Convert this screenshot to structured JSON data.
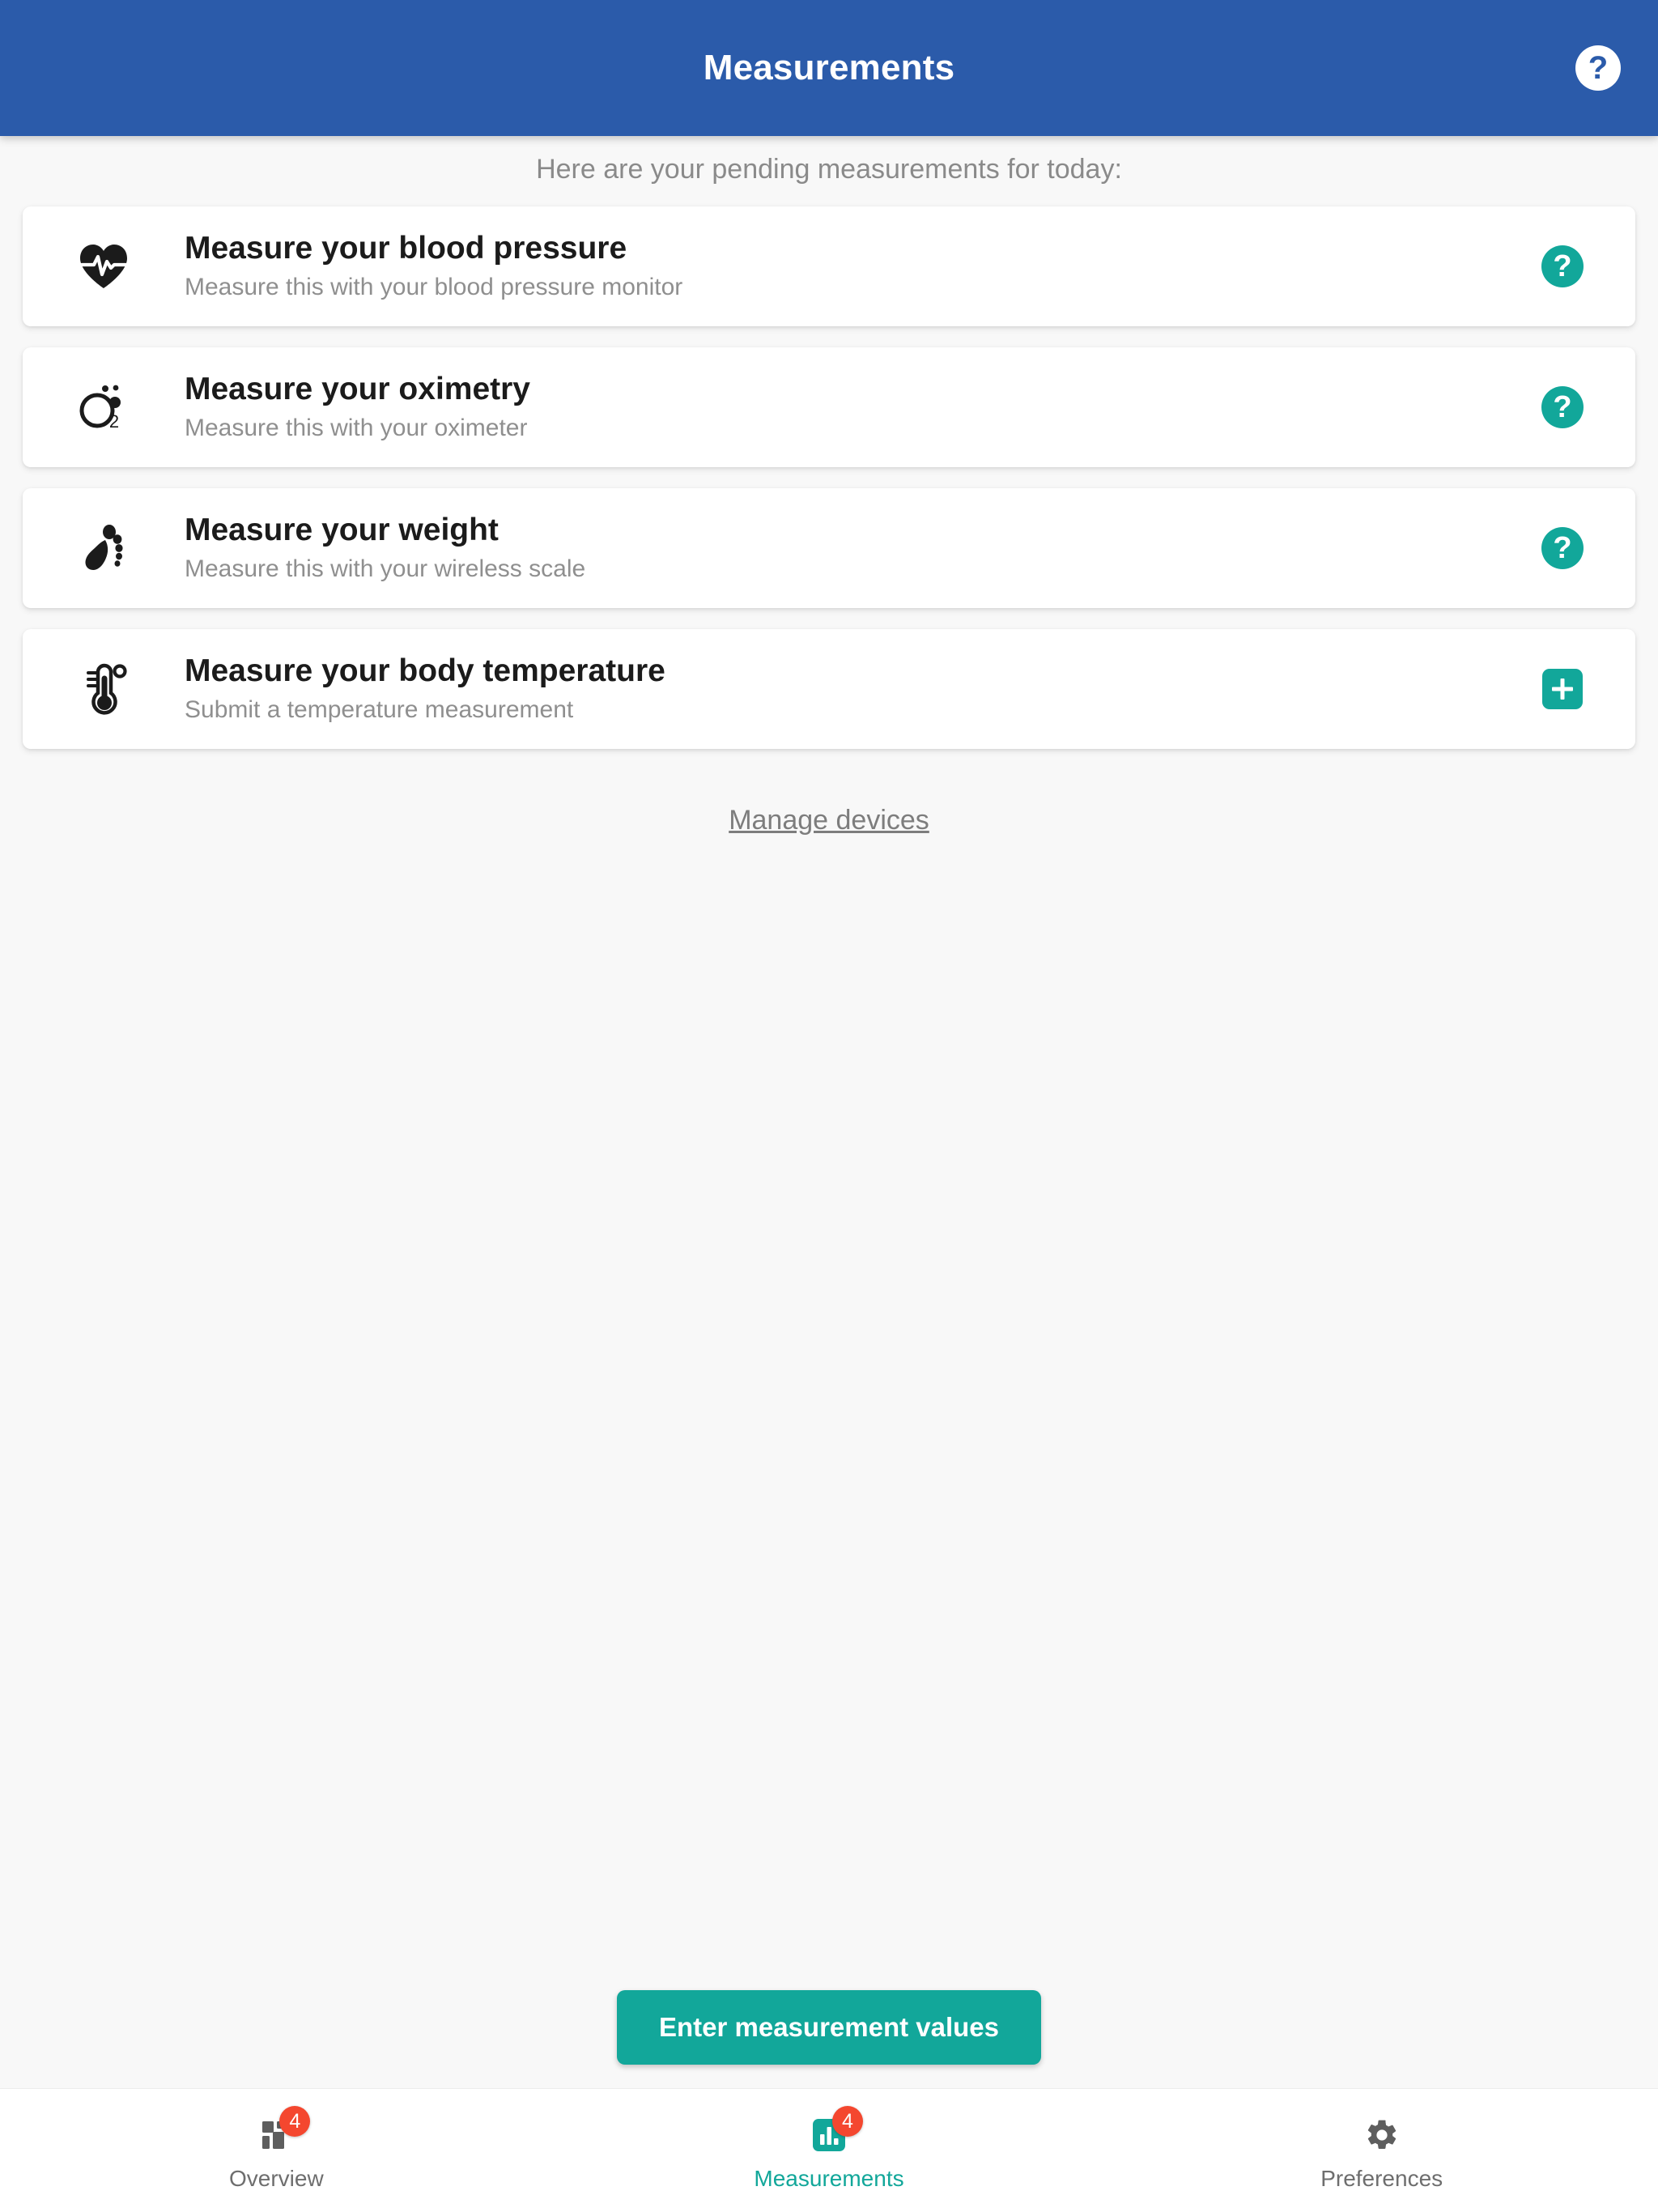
{
  "header": {
    "title": "Measurements",
    "help_icon": "help-circle-icon",
    "help_glyph": "?",
    "background_color": "#2b5baa"
  },
  "main": {
    "intro_text": "Here are your pending measurements for today:",
    "manage_devices_label": "Manage devices",
    "cta_label": "Enter measurement values",
    "accent_color": "#12a79a",
    "cards": [
      {
        "title": "Measure your blood pressure",
        "subtitle": "Measure this with your blood pressure monitor",
        "icon": "heart-pulse-icon",
        "action": "help-circle-button",
        "action_glyph": "?"
      },
      {
        "title": "Measure your oximetry",
        "subtitle": "Measure this with your oximeter",
        "icon": "oxygen-o2-icon",
        "action": "help-circle-button",
        "action_glyph": "?"
      },
      {
        "title": "Measure your weight",
        "subtitle": "Measure this with your wireless scale",
        "icon": "footprint-icon",
        "action": "help-circle-button",
        "action_glyph": "?"
      },
      {
        "title": "Measure your body temperature",
        "subtitle": "Submit a temperature measurement",
        "icon": "thermometer-icon",
        "action": "add-plus-button",
        "action_glyph": "+"
      }
    ]
  },
  "bottom_nav": {
    "items": [
      {
        "label": "Overview",
        "icon": "dashboard-grid-icon",
        "badge": "4",
        "active": false
      },
      {
        "label": "Measurements",
        "icon": "bar-chart-icon",
        "badge": "4",
        "active": true
      },
      {
        "label": "Preferences",
        "icon": "gear-icon",
        "badge": "",
        "active": false
      }
    ],
    "badge_color": "#f4472f"
  }
}
